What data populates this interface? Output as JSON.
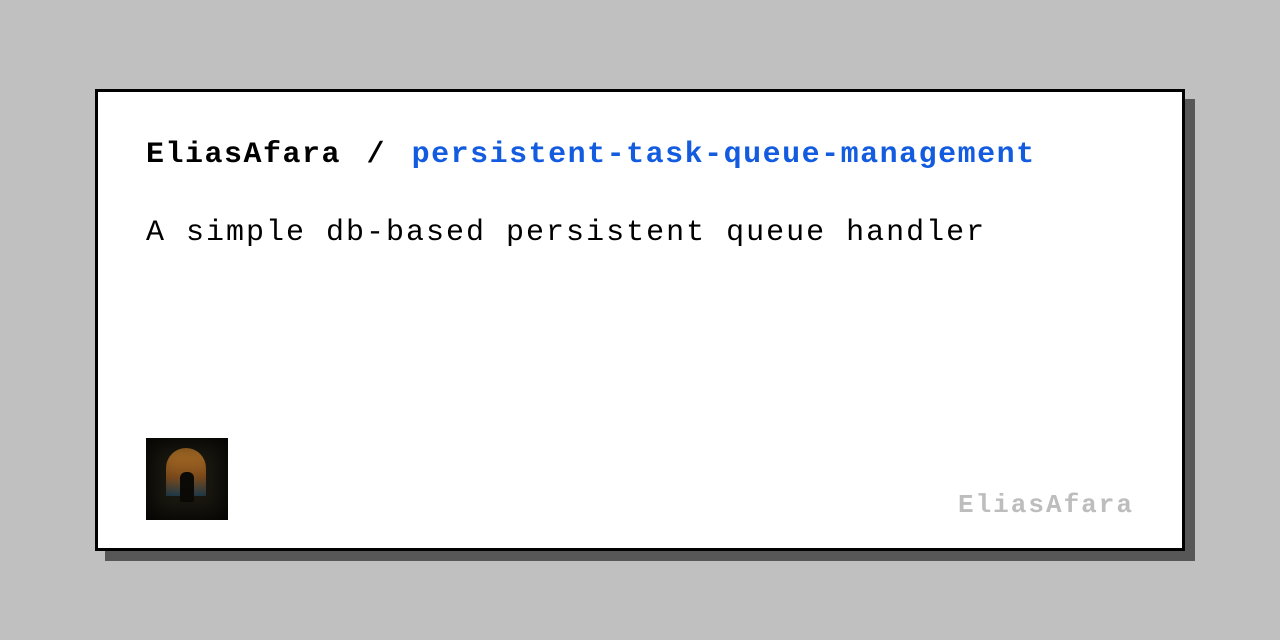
{
  "card": {
    "owner": "EliasAfara",
    "separator": "/",
    "repo": "persistent-task-queue-management",
    "description": "A simple db-based persistent queue handler",
    "signature": "EliasAfara"
  },
  "colors": {
    "background": "#c0c0c0",
    "card_bg": "#ffffff",
    "border": "#000000",
    "link": "#135ce0",
    "muted": "#bdbdbd"
  }
}
